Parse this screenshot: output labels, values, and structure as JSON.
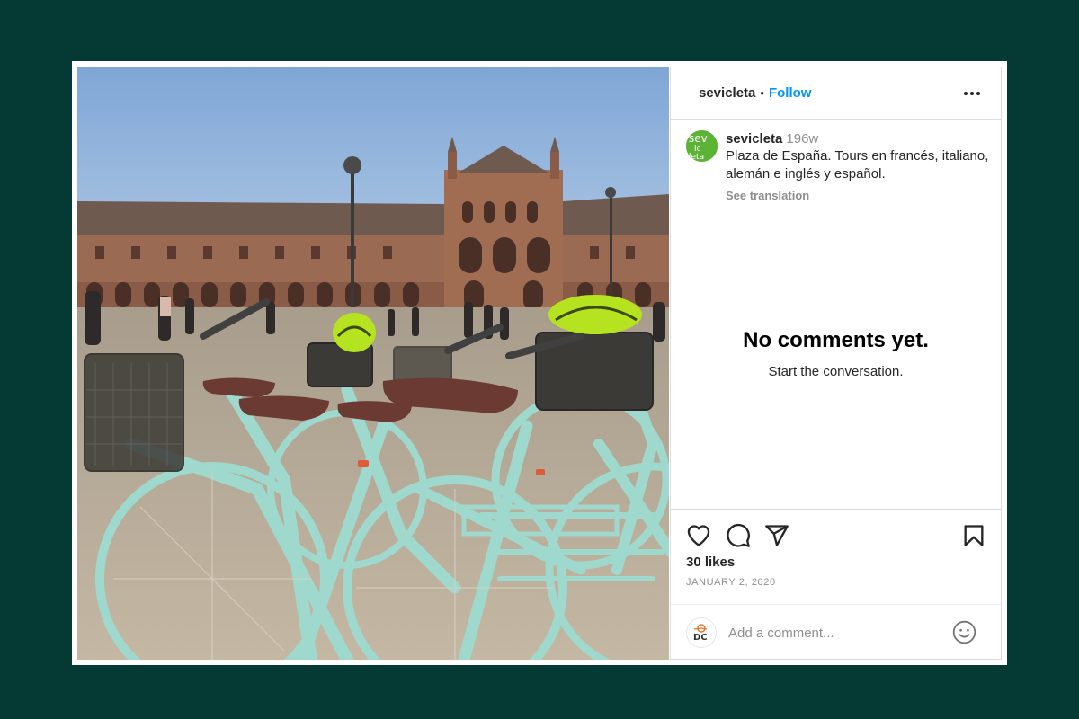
{
  "post": {
    "username": "sevicleta",
    "separator": "•",
    "follow_label": "Follow",
    "more_icon": "more-horizontal-icon"
  },
  "caption": {
    "username": "sevicleta",
    "age": "196w",
    "text": "Plaza de España. Tours en francés, italiano, alemán e inglés y español.",
    "see_translation": "See translation",
    "avatar_text": "sev ic leta"
  },
  "comments": {
    "empty_title": "No comments yet.",
    "empty_subtitle": "Start the conversation."
  },
  "actions": {
    "icons": [
      "heart-icon",
      "comment-icon",
      "share-icon",
      "bookmark-icon"
    ],
    "likes": "30 likes",
    "date": "JANUARY 2, 2020"
  },
  "comment_box": {
    "placeholder": "Add a comment...",
    "avatar_text": "DC",
    "emoji_icon": "emoji-icon"
  },
  "colors": {
    "background": "#053a34",
    "link_blue": "#0095f6",
    "bike_mint": "#9fd8cc",
    "helmet_green": "#b6e31f"
  }
}
